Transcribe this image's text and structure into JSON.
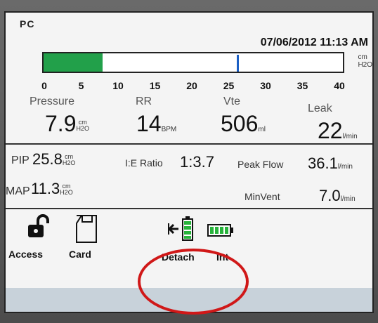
{
  "header": {
    "mode": "PC",
    "date": "07/06/2012",
    "time": "11:13 AM"
  },
  "bar": {
    "unit_top": "cm",
    "unit_bottom": "H2O",
    "scale_min": 0,
    "scale_max": 40,
    "ticks": [
      "0",
      "5",
      "10",
      "15",
      "20",
      "25",
      "30",
      "35",
      "40"
    ],
    "current_pressure": 7.9,
    "pip_marker": 25.8,
    "fill_color": "#22a04a",
    "marker_color": "#1b5fc4"
  },
  "readouts": {
    "pressure": {
      "label": "Pressure",
      "value": "7.9",
      "unit_top": "cm",
      "unit_bottom": "H2O"
    },
    "rr": {
      "label": "RR",
      "value": "14",
      "unit": "BPM"
    },
    "vte": {
      "label": "Vte",
      "value": "506",
      "unit": "ml"
    },
    "leak": {
      "label": "Leak",
      "value": "22",
      "unit": "l/min"
    }
  },
  "secondary": {
    "pip": {
      "label": "PIP",
      "value": "25.8",
      "unit_top": "cm",
      "unit_bottom": "H2O"
    },
    "ie_ratio": {
      "label": "I:E Ratio",
      "value": "1:3.7"
    },
    "peak_flow": {
      "label": "Peak Flow",
      "value": "36.1",
      "unit": "l/min"
    },
    "map": {
      "label": "MAP",
      "value": "11.3",
      "unit_top": "cm",
      "unit_bottom": "H2O"
    },
    "min_vent": {
      "label": "MinVent",
      "value": "7.0",
      "unit": "l/min"
    }
  },
  "buttons": {
    "access": "Access",
    "card": "Card",
    "detach": "Detach",
    "int": "Int"
  },
  "colors": {
    "annotation": "#d01818",
    "battery": "#27b33b"
  }
}
